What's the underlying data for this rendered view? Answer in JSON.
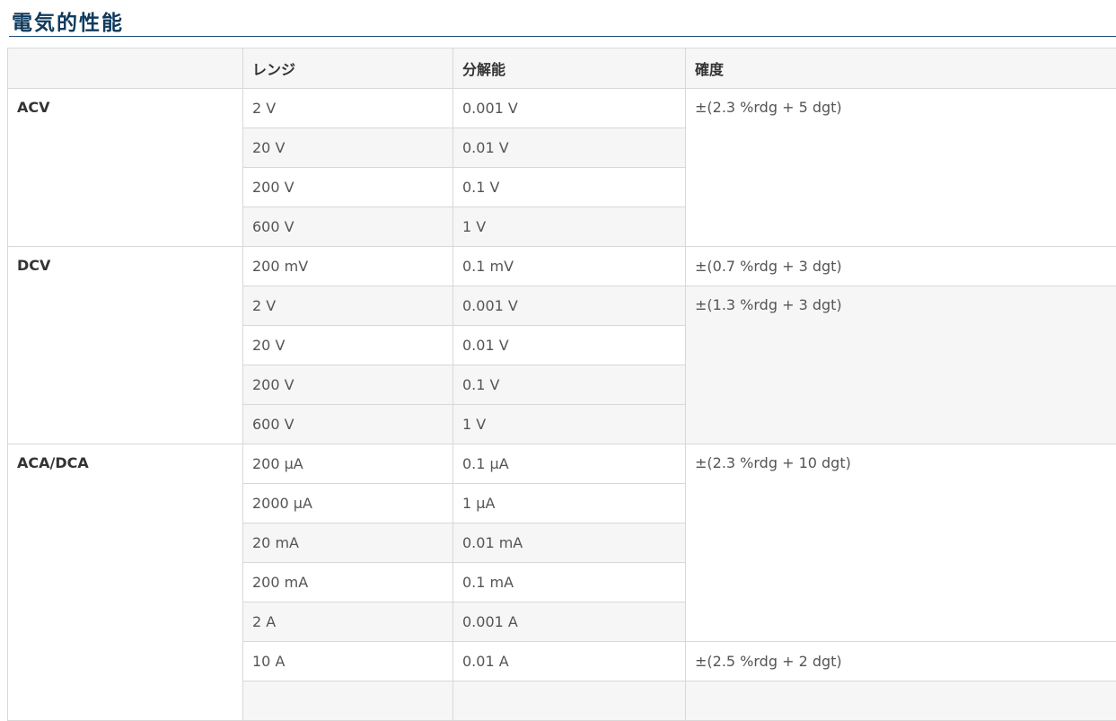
{
  "page_title": "電気的性能",
  "table": {
    "headers": [
      "",
      "レンジ",
      "分解能",
      "確度"
    ],
    "groups": {
      "acv": {
        "label": "ACV",
        "rows": [
          {
            "range": "2 V",
            "resolution": "0.001 V"
          },
          {
            "range": "20 V",
            "resolution": "0.01 V"
          },
          {
            "range": "200 V",
            "resolution": "0.1 V"
          },
          {
            "range": "600 V",
            "resolution": "1 V"
          }
        ],
        "accuracy": [
          "±(2.3 %rdg + 5 dgt)"
        ]
      },
      "dcv": {
        "label": "DCV",
        "rows": [
          {
            "range": "200 mV",
            "resolution": "0.1 mV"
          },
          {
            "range": "2 V",
            "resolution": "0.001 V"
          },
          {
            "range": "20 V",
            "resolution": "0.01 V"
          },
          {
            "range": "200 V",
            "resolution": "0.1 V"
          },
          {
            "range": "600 V",
            "resolution": "1 V"
          }
        ],
        "accuracy": [
          "±(0.7 %rdg + 3 dgt)",
          "±(1.3 %rdg + 3 dgt)"
        ]
      },
      "aca_dca": {
        "label": "ACA/DCA",
        "rows": [
          {
            "range": "200 μA",
            "resolution": "0.1 μA"
          },
          {
            "range": "2000 μA",
            "resolution": "1 μA"
          },
          {
            "range": "20 mA",
            "resolution": "0.01 mA"
          },
          {
            "range": "200 mA",
            "resolution": "0.1 mA"
          },
          {
            "range": "2 A",
            "resolution": "0.001 A"
          },
          {
            "range": "10 A",
            "resolution": "0.01 A"
          }
        ],
        "accuracy": [
          "±(2.3 %rdg + 10 dgt)",
          "±(2.5 %rdg + 2 dgt)"
        ]
      }
    }
  }
}
